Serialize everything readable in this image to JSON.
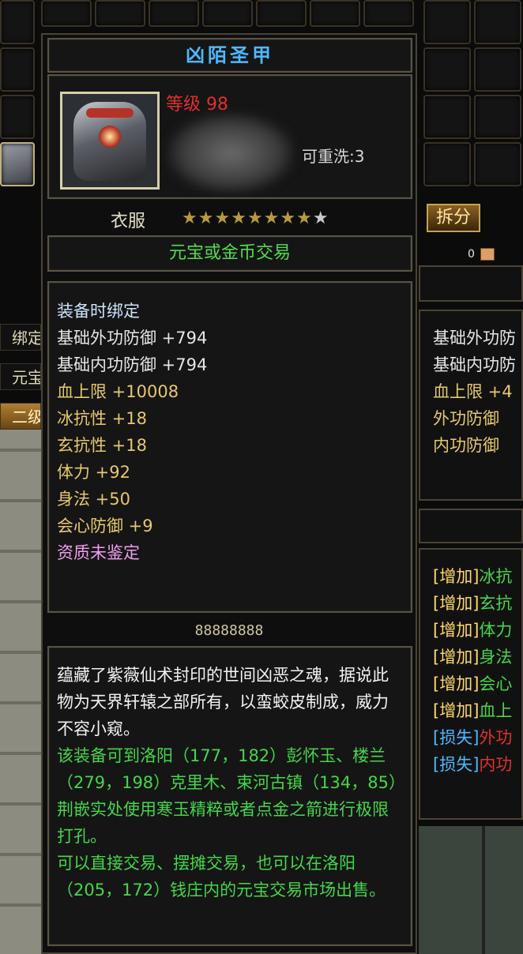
{
  "item": {
    "name": "凶陌圣甲",
    "level_label": "等级 98",
    "rewash": "可重洗:3",
    "type": "衣服",
    "stars": {
      "filled": 8,
      "total": 9
    },
    "trade": "元宝或金币交易",
    "bind": "装备时绑定",
    "attributes": [
      {
        "text": "基础外功防御 +794",
        "color": "white"
      },
      {
        "text": "基础内功防御 +794",
        "color": "white"
      },
      {
        "text": "血上限 +10008",
        "color": "gold"
      },
      {
        "text": "冰抗性 +18",
        "color": "gold"
      },
      {
        "text": "玄抗性 +18",
        "color": "gold"
      },
      {
        "text": "体力 +92",
        "color": "gold"
      },
      {
        "text": "身法 +50",
        "color": "gold"
      },
      {
        "text": "会心防御 +9",
        "color": "gold"
      },
      {
        "text": "资质未鉴定",
        "color": "pink"
      }
    ],
    "code": "88888888",
    "description": [
      {
        "text": "蕴藏了紫薇仙术封印的世间凶恶之魂，据说此物为天界轩辕之部所有，以蛮蛟皮制成，威力不容小窥。",
        "color": "white"
      },
      {
        "text": "该装备可到洛阳（177，182）彭怀玉、楼兰（279，198）克里木、束河古镇（134，85）荆嵌实处使用寒玉精粹或者点金之箭进行极限打孔。",
        "color": "green"
      },
      {
        "text": "可以直接交易、摆摊交易，也可以在洛阳（205，172）钱庄内的元宝交易市场出售。",
        "color": "green"
      }
    ]
  },
  "left_strip": {
    "labels": [
      "绑定",
      "元宝",
      "二级"
    ]
  },
  "right_panel": {
    "split_button": "拆分",
    "counter": "0",
    "base_stats": [
      "基础外功防",
      "基础内功防",
      "血上限 +4",
      "外功防御",
      "内功防御"
    ],
    "changes": [
      {
        "tag": "[增加]",
        "stat": "冰抗",
        "tag_color": "inc",
        "stat_color": "green"
      },
      {
        "tag": "[增加]",
        "stat": "玄抗",
        "tag_color": "inc",
        "stat_color": "green"
      },
      {
        "tag": "[增加]",
        "stat": "体力",
        "tag_color": "inc",
        "stat_color": "green"
      },
      {
        "tag": "[增加]",
        "stat": "身法",
        "tag_color": "inc",
        "stat_color": "green"
      },
      {
        "tag": "[增加]",
        "stat": "会心",
        "tag_color": "inc",
        "stat_color": "green"
      },
      {
        "tag": "[增加]",
        "stat": "血上",
        "tag_color": "inc",
        "stat_color": "green"
      },
      {
        "tag": "[损失]",
        "stat": "外功",
        "tag_color": "loss",
        "stat_color": "red"
      },
      {
        "tag": "[损失]",
        "stat": "内功",
        "tag_color": "loss",
        "stat_color": "red"
      }
    ]
  },
  "colors": {
    "title": "#4fb8ff",
    "level": "#e0312c",
    "trade": "#53dc4f",
    "gold": "#e6c86b",
    "pink": "#f19cf0",
    "green": "#45d64a"
  }
}
